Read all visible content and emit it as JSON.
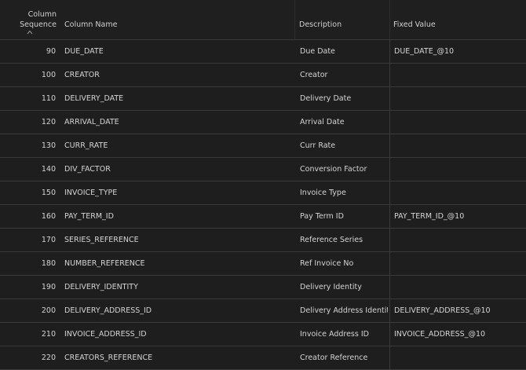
{
  "header": {
    "sequence_label_line1": "Column",
    "sequence_label_line2": "Sequence",
    "sort_icon": "sort-ascending-icon",
    "name_label": "Column Name",
    "description_label": "Description",
    "fixed_value_label": "Fixed Value"
  },
  "rows": [
    {
      "sequence": "90",
      "name": "DUE_DATE",
      "description": "Due Date",
      "fixed_value": "DUE_DATE_@10"
    },
    {
      "sequence": "100",
      "name": "CREATOR",
      "description": "Creator",
      "fixed_value": ""
    },
    {
      "sequence": "110",
      "name": "DELIVERY_DATE",
      "description": "Delivery Date",
      "fixed_value": ""
    },
    {
      "sequence": "120",
      "name": "ARRIVAL_DATE",
      "description": "Arrival Date",
      "fixed_value": ""
    },
    {
      "sequence": "130",
      "name": "CURR_RATE",
      "description": "Curr Rate",
      "fixed_value": ""
    },
    {
      "sequence": "140",
      "name": "DIV_FACTOR",
      "description": "Conversion Factor",
      "fixed_value": ""
    },
    {
      "sequence": "150",
      "name": "INVOICE_TYPE",
      "description": "Invoice Type",
      "fixed_value": ""
    },
    {
      "sequence": "160",
      "name": "PAY_TERM_ID",
      "description": "Pay Term ID",
      "fixed_value": "PAY_TERM_ID_@10"
    },
    {
      "sequence": "170",
      "name": "SERIES_REFERENCE",
      "description": "Reference Series",
      "fixed_value": ""
    },
    {
      "sequence": "180",
      "name": "NUMBER_REFERENCE",
      "description": "Ref Invoice No",
      "fixed_value": ""
    },
    {
      "sequence": "190",
      "name": "DELIVERY_IDENTITY",
      "description": "Delivery Identity",
      "fixed_value": ""
    },
    {
      "sequence": "200",
      "name": "DELIVERY_ADDRESS_ID",
      "description": "Delivery Address Identity",
      "fixed_value": "DELIVERY_ADDRESS_@10"
    },
    {
      "sequence": "210",
      "name": "INVOICE_ADDRESS_ID",
      "description": "Invoice Address ID",
      "fixed_value": "INVOICE_ADDRESS_@10"
    },
    {
      "sequence": "220",
      "name": "CREATORS_REFERENCE",
      "description": "Creator Reference",
      "fixed_value": ""
    }
  ]
}
